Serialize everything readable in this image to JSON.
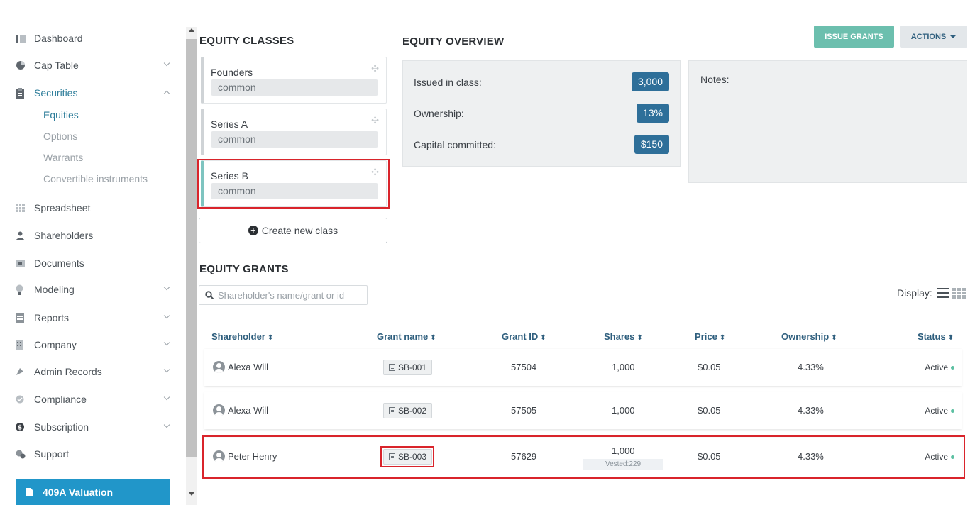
{
  "sidebar": {
    "items": [
      {
        "label": "Dashboard",
        "icon": "dashboard-icon"
      },
      {
        "label": "Cap Table",
        "icon": "pie-chart-icon"
      },
      {
        "label": "Securities",
        "icon": "clipboard-icon"
      },
      {
        "label": "Spreadsheet",
        "icon": "spreadsheet-icon"
      },
      {
        "label": "Shareholders",
        "icon": "person-icon"
      },
      {
        "label": "Documents",
        "icon": "folder-icon"
      },
      {
        "label": "Modeling",
        "icon": "lightbulb-icon"
      },
      {
        "label": "Reports",
        "icon": "report-icon"
      },
      {
        "label": "Company",
        "icon": "building-icon"
      },
      {
        "label": "Admin Records",
        "icon": "records-icon"
      },
      {
        "label": "Compliance",
        "icon": "shield-check-icon"
      },
      {
        "label": "Subscription",
        "icon": "dollar-circle-icon"
      },
      {
        "label": "Support",
        "icon": "support-icon"
      }
    ],
    "securities_sub": [
      "Equities",
      "Options",
      "Warrants",
      "Convertible instruments"
    ],
    "valuation_button": "409A Valuation"
  },
  "equity_classes": {
    "title": "EQUITY CLASSES",
    "classes": [
      {
        "name": "Founders",
        "type": "common"
      },
      {
        "name": "Series A",
        "type": "common"
      },
      {
        "name": "Series B",
        "type": "common"
      }
    ],
    "create_label": "Create new class"
  },
  "overview": {
    "title": "EQUITY OVERVIEW",
    "issued_label": "Issued in class:",
    "issued_value": "3,000",
    "ownership_label": "Ownership:",
    "ownership_value": "13%",
    "capital_label": "Capital committed:",
    "capital_value": "$150",
    "notes_label": "Notes:"
  },
  "toolbar": {
    "issue_label": "ISSUE GRANTS",
    "actions_label": "ACTIONS"
  },
  "grants": {
    "title": "EQUITY GRANTS",
    "search_placeholder": "Shareholder's name/grant or id",
    "display_label": "Display:",
    "columns": [
      "Shareholder",
      "Grant name",
      "Grant ID",
      "Shares",
      "Price",
      "Ownership",
      "Status"
    ],
    "rows": [
      {
        "shareholder": "Alexa Will",
        "grant_name": "SB-001",
        "grant_id": "57504",
        "shares": "1,000",
        "vested": "",
        "price": "$0.05",
        "ownership": "4.33%",
        "status": "Active"
      },
      {
        "shareholder": "Alexa Will",
        "grant_name": "SB-002",
        "grant_id": "57505",
        "shares": "1,000",
        "vested": "",
        "price": "$0.05",
        "ownership": "4.33%",
        "status": "Active"
      },
      {
        "shareholder": "Peter Henry",
        "grant_name": "SB-003",
        "grant_id": "57629",
        "shares": "1,000",
        "vested": "Vested:229",
        "price": "$0.05",
        "ownership": "4.33%",
        "status": "Active"
      }
    ]
  },
  "colors": {
    "accent": "#2196c9",
    "issue_button": "#6cbfae",
    "badge": "#2e6f99",
    "highlight": "#d9242b",
    "status_dot": "#5cc0a2"
  }
}
